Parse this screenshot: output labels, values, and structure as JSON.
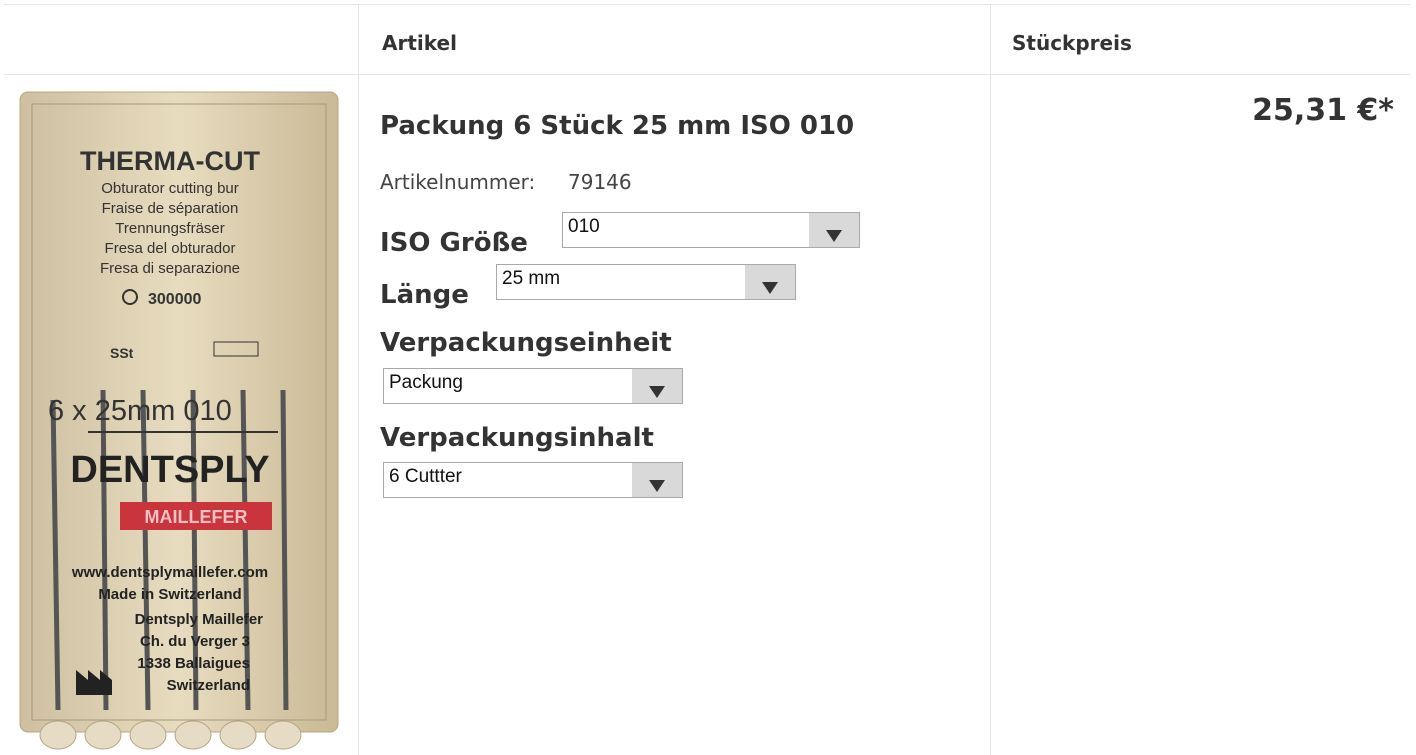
{
  "header": {
    "col_article": "Artikel",
    "col_unit_price": "Stückpreis"
  },
  "product": {
    "image": {
      "icon": "product-image",
      "box_title": "THERMA-CUT",
      "box_lines": [
        "Obturator cutting bur",
        "Fraise de séparation",
        "Trennungsfräser",
        "Fresa del obturador",
        "Fresa di separazione"
      ],
      "box_speed": "300000",
      "box_size": "6 x  25mm  010",
      "box_brand": "DENTSPLY",
      "box_sub": "MAILLEFER",
      "box_url": "www.dentsplymaillefer.com",
      "box_made": "Made in Switzerland",
      "box_address": [
        "Dentsply Maillefer",
        "Ch. du Verger 3",
        "1338 Ballaigues",
        "Switzerland"
      ]
    },
    "title": "Packung 6 Stück 25 mm ISO 010",
    "article_number_label": "Artikelnummer:",
    "article_number": "79146",
    "options": {
      "iso_label": "ISO Größe",
      "iso_value": "010",
      "length_label": "Länge",
      "length_value": "25 mm",
      "unit_label": "Verpackungseinheit",
      "unit_value": "Packung",
      "content_label": "Verpackungsinhalt",
      "content_value": "6 Cuttter"
    },
    "price": "25,31 €*"
  }
}
